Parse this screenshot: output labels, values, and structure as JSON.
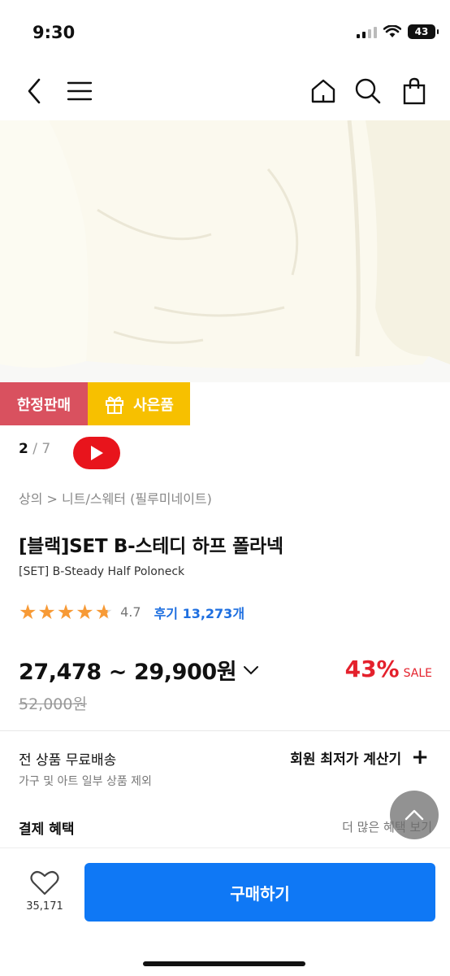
{
  "status": {
    "time": "9:30",
    "battery": "43"
  },
  "icons": {
    "back": "chevron-left-icon",
    "menu": "hamburger-menu-icon",
    "home": "home-icon",
    "search": "search-icon",
    "cart": "shopping-bag-icon",
    "gift": "gift-icon",
    "youtube": "youtube-play-icon",
    "heart": "heart-icon",
    "scroll_top": "chevron-up-icon"
  },
  "colors": {
    "limited": "#d9515f",
    "gift": "#f7c000",
    "discount": "#e4212c",
    "review_link": "#1e6fe0",
    "buy_button": "#0f78f5",
    "star": "#f79a36"
  },
  "promo": {
    "limited_label": "한정판매",
    "gift_label": "사은품"
  },
  "gallery": {
    "current": "2",
    "separator": "/",
    "total": "7"
  },
  "breadcrumb": "상의 > 니트/스웨터 (필루미네이트)",
  "product": {
    "title": "[블랙]SET B-스테디 하프 폴라넥",
    "subtitle": "[SET] B-Steady Half Poloneck",
    "rating": "4.7",
    "rating_fraction": 0.94,
    "reviews": "후기 13,273개",
    "price_range": "27,478 ~ 29,900원",
    "discount_percent": "43%",
    "sale_label": "SALE",
    "original_price": "52,000원"
  },
  "shipping": {
    "title": "전 상품 무료배송",
    "subtitle": "가구 및 아트 일부 상품 제외",
    "calc_label": "회원 최저가 계산기",
    "calc_icon": "+"
  },
  "payment": {
    "title": "결제 혜택",
    "more_label": "더 많은 혜택 보기"
  },
  "bottom": {
    "like_count": "35,171",
    "buy_label": "구매하기"
  }
}
